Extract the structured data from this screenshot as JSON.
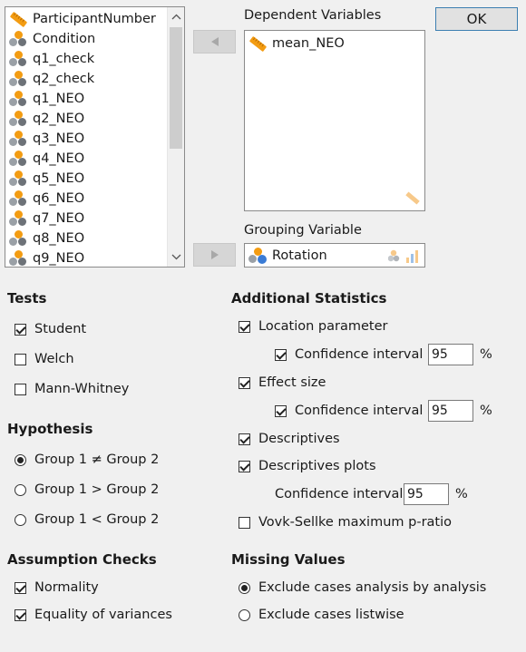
{
  "ok_label": "OK",
  "variables": [
    {
      "name": "ParticipantNumber",
      "type": "scale"
    },
    {
      "name": "Condition",
      "type": "nominal"
    },
    {
      "name": "q1_check",
      "type": "nominal"
    },
    {
      "name": "q2_check",
      "type": "nominal"
    },
    {
      "name": "q1_NEO",
      "type": "nominal"
    },
    {
      "name": "q2_NEO",
      "type": "nominal"
    },
    {
      "name": "q3_NEO",
      "type": "nominal"
    },
    {
      "name": "q4_NEO",
      "type": "nominal"
    },
    {
      "name": "q5_NEO",
      "type": "nominal"
    },
    {
      "name": "q6_NEO",
      "type": "nominal"
    },
    {
      "name": "q7_NEO",
      "type": "nominal"
    },
    {
      "name": "q8_NEO",
      "type": "nominal"
    },
    {
      "name": "q9_NEO",
      "type": "nominal"
    }
  ],
  "dependent": {
    "title": "Dependent Variables",
    "items": [
      {
        "name": "mean_NEO",
        "type": "scale"
      }
    ]
  },
  "grouping": {
    "title": "Grouping Variable",
    "value": "Rotation"
  },
  "tests": {
    "title": "Tests",
    "options": [
      {
        "label": "Student",
        "checked": true
      },
      {
        "label": "Welch",
        "checked": false
      },
      {
        "label": "Mann-Whitney",
        "checked": false
      }
    ]
  },
  "hypothesis": {
    "title": "Hypothesis",
    "options": [
      {
        "label": "Group 1 ≠ Group 2",
        "selected": true
      },
      {
        "label": "Group 1 > Group 2",
        "selected": false
      },
      {
        "label": "Group 1 < Group 2",
        "selected": false
      }
    ]
  },
  "assumptions": {
    "title": "Assumption Checks",
    "options": [
      {
        "label": "Normality",
        "checked": true
      },
      {
        "label": "Equality of variances",
        "checked": true
      }
    ]
  },
  "additional": {
    "title": "Additional Statistics",
    "location": {
      "label": "Location parameter",
      "checked": true,
      "ci_label": "Confidence interval",
      "ci_checked": true,
      "ci_value": "95",
      "unit": "%"
    },
    "effect": {
      "label": "Effect size",
      "checked": true,
      "ci_label": "Confidence interval",
      "ci_checked": true,
      "ci_value": "95",
      "unit": "%"
    },
    "descriptives": {
      "label": "Descriptives",
      "checked": true
    },
    "plots": {
      "label": "Descriptives plots",
      "checked": true,
      "ci_label": "Confidence interval",
      "ci_value": "95",
      "unit": "%"
    },
    "vovk": {
      "label": "Vovk-Sellke maximum p-ratio",
      "checked": false
    }
  },
  "missing": {
    "title": "Missing Values",
    "options": [
      {
        "label": "Exclude cases analysis by analysis",
        "selected": true
      },
      {
        "label": "Exclude cases listwise",
        "selected": false
      }
    ]
  }
}
